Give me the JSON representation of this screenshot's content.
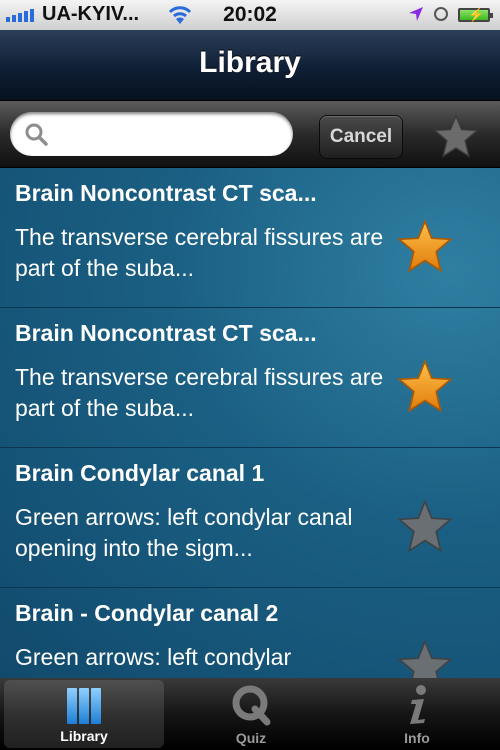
{
  "status_bar": {
    "carrier": "UA-KYIV...",
    "time": "20:02"
  },
  "nav": {
    "title": "Library"
  },
  "search": {
    "value": "",
    "placeholder": "",
    "cancel_label": "Cancel"
  },
  "items": [
    {
      "title": "Brain Noncontrast CT sca...",
      "description": "The transverse cerebral fissures are part of the suba...",
      "favorite": true
    },
    {
      "title": "Brain Noncontrast CT sca...",
      "description": "The transverse cerebral fissures are part of the suba...",
      "favorite": true
    },
    {
      "title": "Brain Condylar canal 1",
      "description": "Green arrows: left condylar canal opening into the sigm...",
      "favorite": false
    },
    {
      "title": "Brain - Condylar canal 2",
      "description": "Green arrows: left condylar",
      "favorite": false
    }
  ],
  "tabs": [
    {
      "label": "Library",
      "icon": "library-icon",
      "active": true
    },
    {
      "label": "Quiz",
      "icon": "quiz-icon",
      "active": false
    },
    {
      "label": "Info",
      "icon": "info-icon",
      "active": false
    }
  ],
  "colors": {
    "star_active": "#f29a18",
    "star_inactive": "#6a6f74",
    "list_background": "#1a5f83",
    "nav_background": "#0f1f35"
  }
}
